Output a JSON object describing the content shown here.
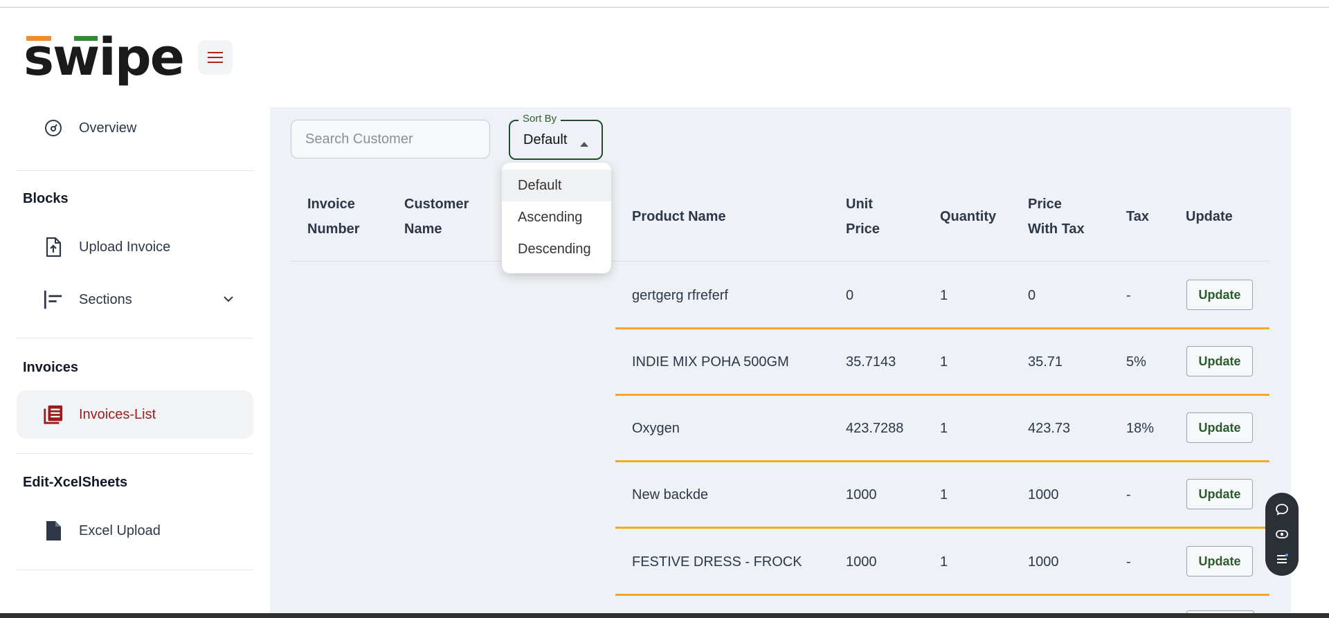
{
  "app": {
    "logo_text": "swipe"
  },
  "sidebar": {
    "overview": "Overview",
    "blocks_title": "Blocks",
    "upload_invoice": "Upload Invoice",
    "sections": "Sections",
    "invoices_title": "Invoices",
    "invoices_list": "Invoices-List",
    "excel_title": "Edit-XcelSheets",
    "excel_upload": "Excel Upload"
  },
  "toolbar": {
    "search_placeholder": "Search Customer",
    "sort_label": "Sort By",
    "sort_value": "Default",
    "sort_options": [
      "Default",
      "Ascending",
      "Descending"
    ]
  },
  "table": {
    "headers": {
      "invoice_number": [
        "Invoice",
        "Number"
      ],
      "customer_name": [
        "Customer",
        "Name"
      ],
      "product_name": "Product Name",
      "unit_price": [
        "Unit",
        "Price"
      ],
      "quantity": "Quantity",
      "price_with_tax": [
        "Price",
        "With Tax"
      ],
      "tax": "Tax",
      "update": "Update"
    },
    "rows": [
      {
        "product": "gertgerg rfreferf",
        "unit_price": "0",
        "qty": "1",
        "price_tax": "0",
        "tax": "-",
        "action": "Update"
      },
      {
        "product": "INDIE MIX POHA 500GM",
        "unit_price": "35.7143",
        "qty": "1",
        "price_tax": "35.71",
        "tax": "5%",
        "action": "Update"
      },
      {
        "product": "Oxygen",
        "unit_price": "423.7288",
        "qty": "1",
        "price_tax": "423.73",
        "tax": "18%",
        "action": "Update"
      },
      {
        "product": "New backde",
        "unit_price": "1000",
        "qty": "1",
        "price_tax": "1000",
        "tax": "-",
        "action": "Update"
      },
      {
        "product": "FESTIVE DRESS - FROCK",
        "unit_price": "1000",
        "qty": "1",
        "price_tax": "1000",
        "tax": "-",
        "action": "Update"
      }
    ]
  },
  "colors": {
    "accent_red": "#9b1c1c",
    "row_separator": "#f5a623",
    "sort_border": "#1f4d2b"
  },
  "icons": {
    "menu": "hamburger-icon",
    "overview": "gauge-icon",
    "upload": "file-upload-icon",
    "sections": "align-left-icon",
    "invoices": "list-document-icon",
    "excel": "file-icon",
    "chat": "chat-icon",
    "eye": "eye-icon",
    "list": "list-icon"
  }
}
